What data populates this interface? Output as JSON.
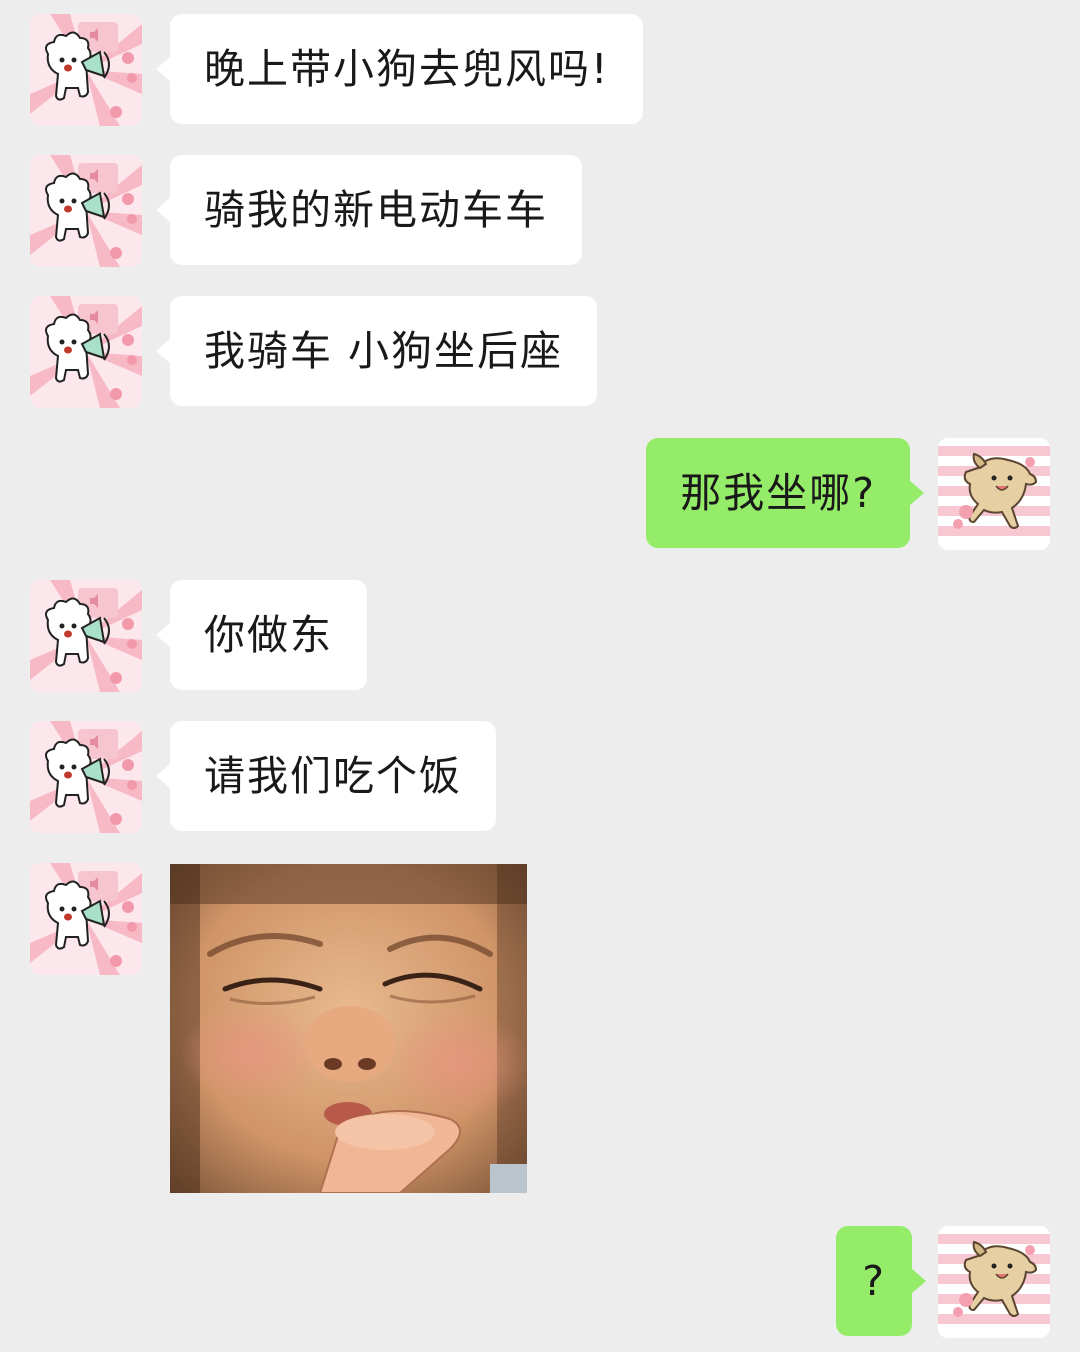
{
  "chat": {
    "messages": [
      {
        "side": "left",
        "text": "晚上带小狗去兜风吗!"
      },
      {
        "side": "left",
        "text": "骑我的新电动车车"
      },
      {
        "side": "left",
        "text": "我骑车 小狗坐后座"
      },
      {
        "side": "right",
        "text": "那我坐哪?"
      },
      {
        "side": "left",
        "text": "你做东"
      },
      {
        "side": "left",
        "text": "请我们吃个饭"
      },
      {
        "side": "left",
        "type": "image",
        "image": "baby-squinting-face-photo"
      },
      {
        "side": "right",
        "text": "?"
      }
    ]
  },
  "avatars": {
    "friend": "alpaca-megaphone-avatar",
    "me": "dancing-dog-avatar"
  },
  "colors": {
    "background": "#ededed",
    "incoming_bubble": "#ffffff",
    "outgoing_bubble": "#95ec69",
    "text": "#191919"
  }
}
